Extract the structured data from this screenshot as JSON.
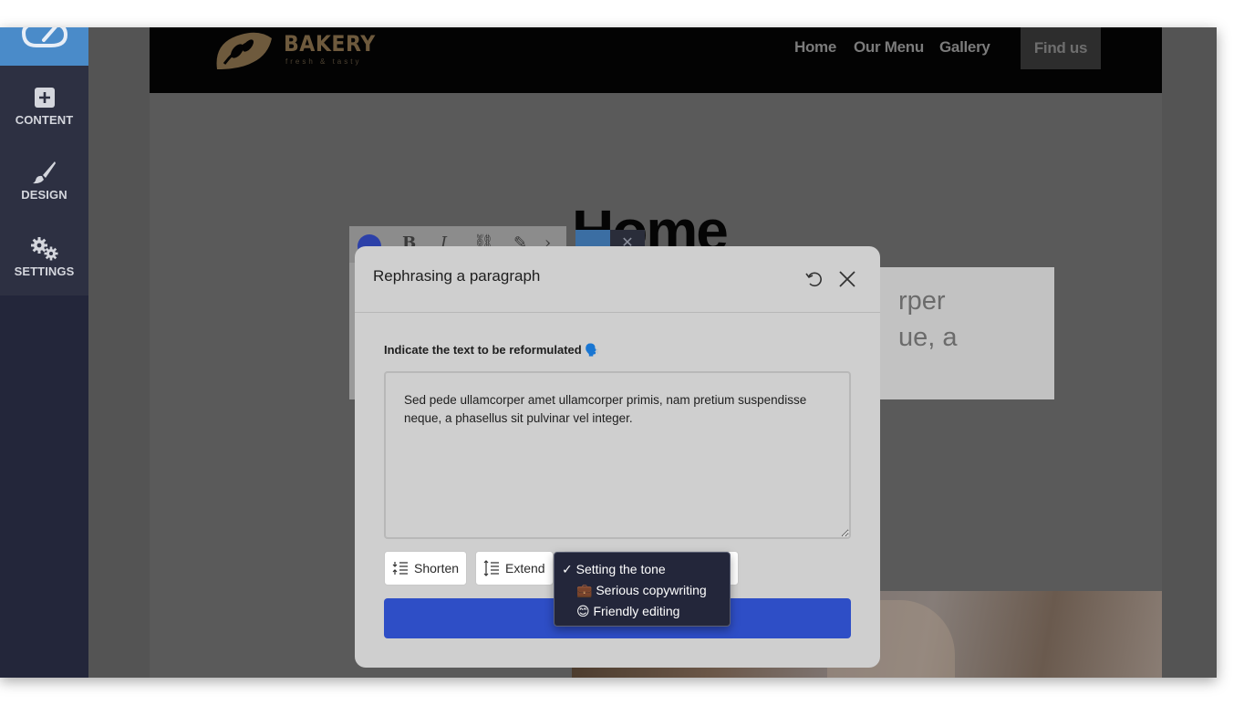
{
  "sidebar": {
    "items": [
      {
        "label": "CONTENT",
        "icon": "plus-square-icon"
      },
      {
        "label": "DESIGN",
        "icon": "paintbrush-icon"
      },
      {
        "label": "SETTINGS",
        "icon": "gears-icon"
      }
    ]
  },
  "site": {
    "logo_text": "BAKERY",
    "logo_sub": "fresh & tasty",
    "nav": [
      "Home",
      "Our Menu",
      "Gallery"
    ],
    "cta": "Find us",
    "hero_title": "Home",
    "para_lines": [
      "rper",
      "ue, a"
    ]
  },
  "modal": {
    "title": "Rephrasing a paragraph",
    "prompt": "Indicate the text to be reformulated",
    "prompt_emoji": "🗣️",
    "textarea_value": "Sed pede ullamcorper amet ullamcorper primis, nam pretium suspendisse neque, a phasellus sit pulvinar vel integer.",
    "buttons": {
      "shorten": "Shorten",
      "extend": "Extend"
    }
  },
  "dropdown": {
    "selected": "Setting the tone",
    "check": "✓",
    "options": [
      {
        "emoji": "💼",
        "label": "Serious copywriting"
      },
      {
        "emoji": "😊",
        "label": "Friendly editing"
      }
    ]
  },
  "colors": {
    "sidebar_bg": "#23263a",
    "sidebar_active": "#4a8bc9",
    "modal_bg": "#cfcfcf",
    "submit_bg": "#2e4ec6"
  }
}
